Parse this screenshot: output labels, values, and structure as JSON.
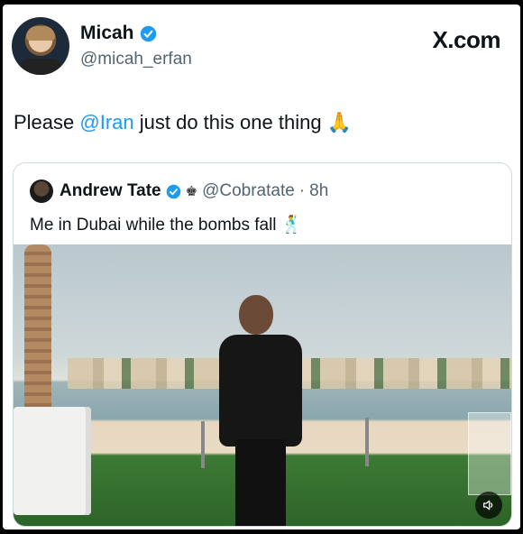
{
  "tweet": {
    "author_name": "Micah",
    "author_handle": "@micah_erfan",
    "brand": "X.com",
    "text_before": "Please ",
    "mention": "@Iran",
    "text_after": " just do this one thing 🙏"
  },
  "quoted": {
    "author_name": "Andrew Tate",
    "handle": "@Cobratate",
    "separator": "·",
    "time": "8h",
    "text": "Me in Dubai while the bombs fall 🕺"
  },
  "media": {
    "sound_icon": "speaker-muted-icon"
  },
  "colors": {
    "accent": "#1d9bf0",
    "secondary_text": "#536471",
    "border": "#cfd9de"
  }
}
